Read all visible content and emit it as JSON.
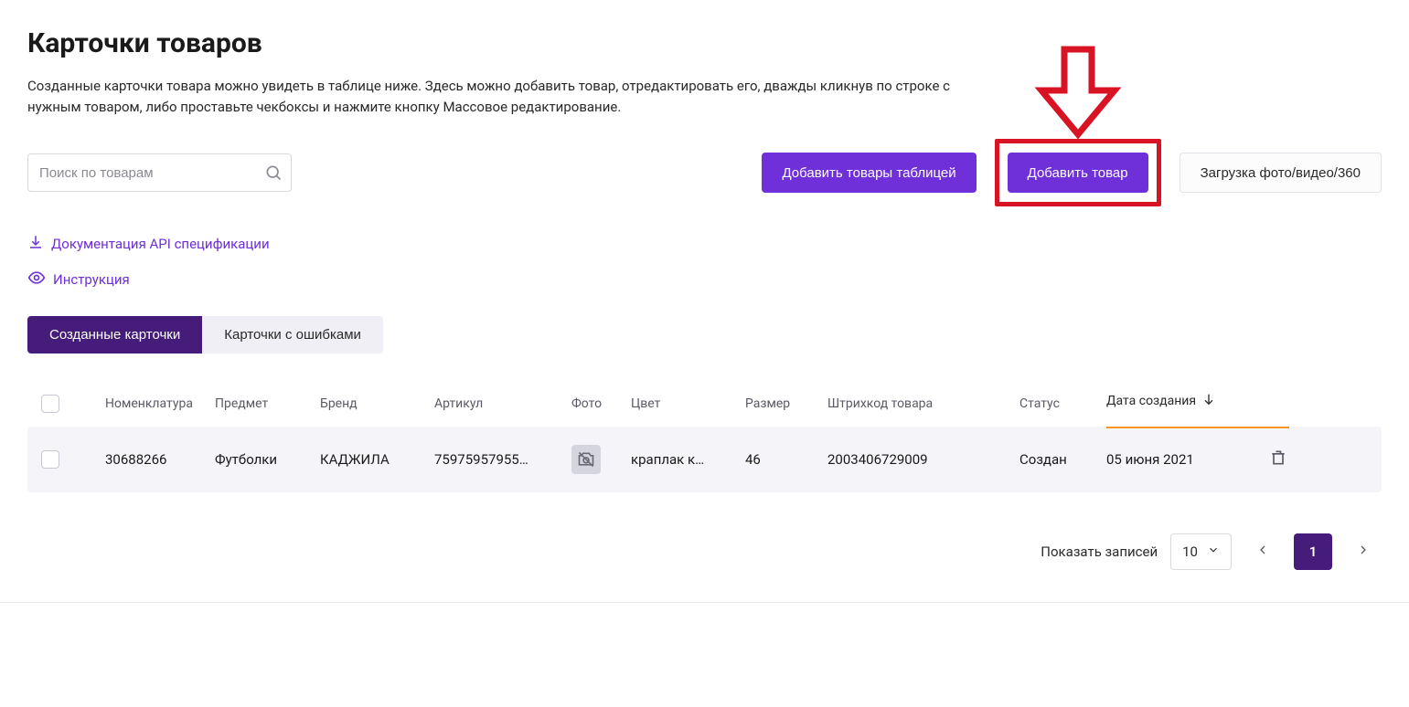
{
  "header": {
    "title": "Карточки товаров",
    "description": "Созданные карточки товара можно увидеть в таблице ниже. Здесь можно добавить товар, отредактировать его, дважды кликнув по строке с нужным товаром, либо проставьте чекбоксы и нажмите кнопку Массовое редактирование."
  },
  "search": {
    "placeholder": "Поиск по товарам"
  },
  "buttons": {
    "add_table": "Добавить товары таблицей",
    "add_product": "Добавить товар",
    "upload_media": "Загрузка фото/видео/360"
  },
  "links": {
    "api_doc": "Документация API спецификации",
    "instruction": "Инструкция"
  },
  "tabs": {
    "created": "Созданные карточки",
    "errors": "Карточки с ошибками"
  },
  "columns": {
    "nomenclature": "Номенклатура",
    "subject": "Предмет",
    "brand": "Бренд",
    "article": "Артикул",
    "photo": "Фото",
    "color": "Цвет",
    "size": "Размер",
    "barcode": "Штрихкод товара",
    "status": "Статус",
    "created": "Дата создания"
  },
  "rows": [
    {
      "nomenclature": "30688266",
      "subject": "Футболки",
      "brand": "КАДЖИЛА",
      "article": "75975957955…",
      "color": "краплак к…",
      "size": "46",
      "barcode": "2003406729009",
      "status": "Создан",
      "created": "05 июня 2021"
    }
  ],
  "pagination": {
    "label": "Показать записей",
    "page_size": "10",
    "current": "1"
  }
}
